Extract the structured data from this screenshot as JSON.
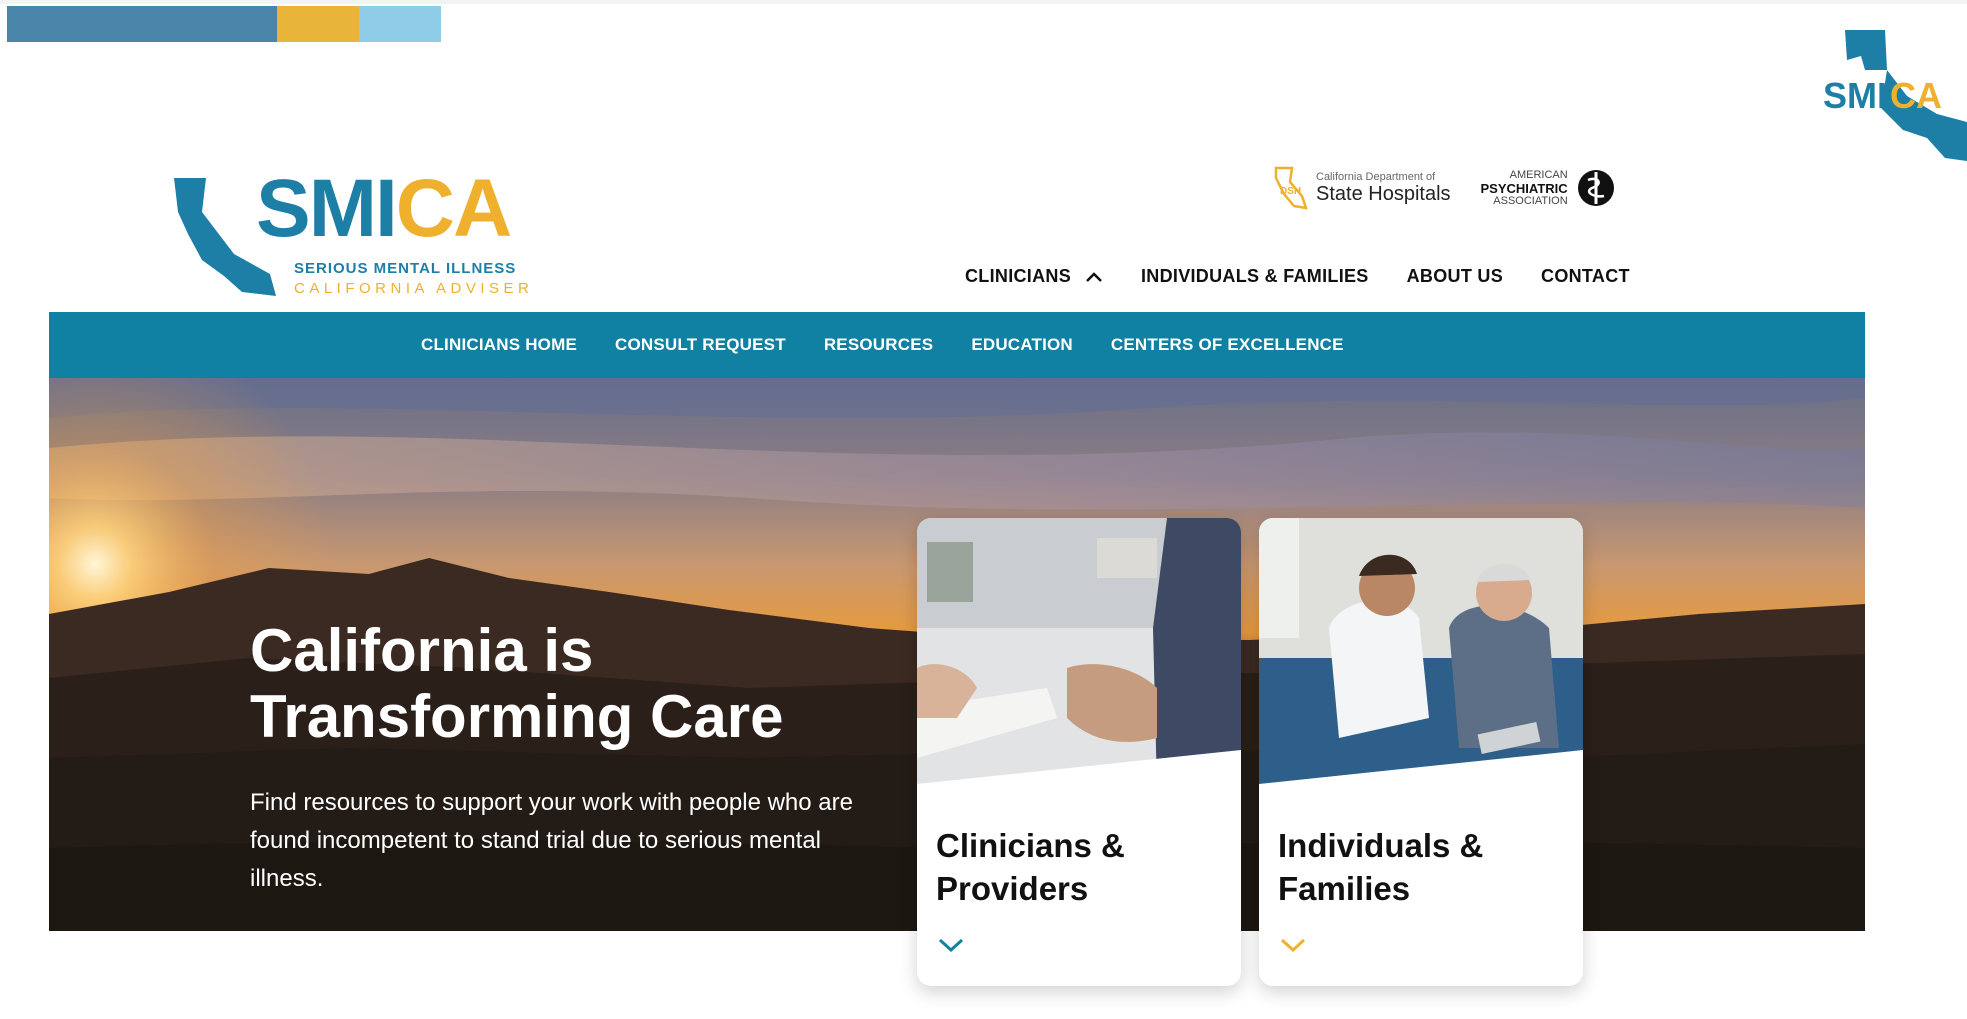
{
  "brand": {
    "logo_smi": "SMI",
    "logo_ca": "CA",
    "tagline_1": "SERIOUS MENTAL ILLNESS",
    "tagline_2": "CALIFORNIA ADVISER",
    "primary_color": "#1181a3",
    "accent_color": "#efb02e"
  },
  "partners": {
    "dsh_small": "California Department of",
    "dsh_name": "State Hospitals",
    "apa_line1": "AMERICAN",
    "apa_line2": "PSYCHIATRIC",
    "apa_line3": "ASSOCIATION"
  },
  "main_nav": [
    {
      "label": "CLINICIANS",
      "expanded": true
    },
    {
      "label": "INDIVIDUALS & FAMILIES"
    },
    {
      "label": "ABOUT US"
    },
    {
      "label": "CONTACT"
    }
  ],
  "sub_nav": [
    {
      "label": "CLINICIANS HOME"
    },
    {
      "label": "CONSULT REQUEST"
    },
    {
      "label": "RESOURCES"
    },
    {
      "label": "EDUCATION"
    },
    {
      "label": "CENTERS OF EXCELLENCE"
    }
  ],
  "hero": {
    "title": "California is Transforming Care",
    "text": "Find resources to support your work with people who are found incompetent to stand trial due to serious mental illness."
  },
  "cards": [
    {
      "title": "Clinicians & Providers",
      "chevron_color": "#1181a3",
      "icon": "chevron-down-icon"
    },
    {
      "title": "Individuals & Families",
      "chevron_color": "#efb02e",
      "icon": "chevron-down-icon"
    }
  ]
}
